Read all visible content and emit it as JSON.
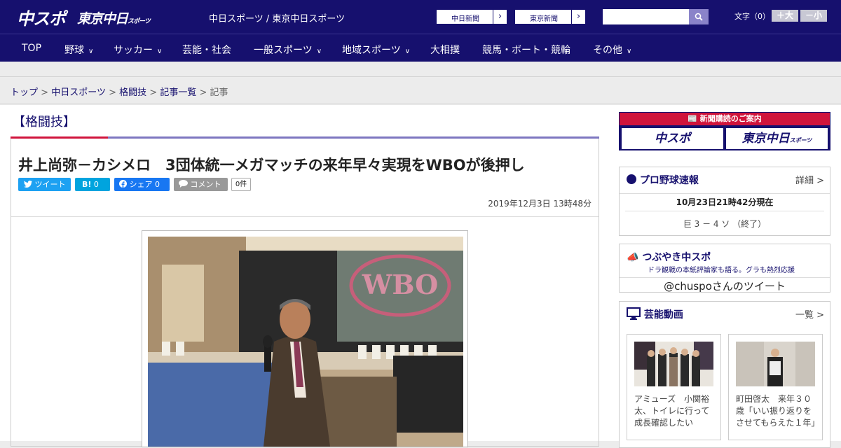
{
  "header": {
    "logo_main": "中スポ",
    "logo_tokyo": "東京中日",
    "logo_tokyo_small": "スポーツ",
    "site_name": "中日スポーツ / 東京中日スポーツ",
    "paper_buttons": [
      "中日新聞",
      "東京新聞"
    ],
    "search_placeholder": "",
    "font_size_label": "文字（0）",
    "font_larger": "＋大",
    "font_smaller": "－小"
  },
  "nav": {
    "items": [
      {
        "label": "TOP",
        "dropdown": false
      },
      {
        "label": "野球",
        "dropdown": true
      },
      {
        "label": "サッカー",
        "dropdown": true
      },
      {
        "label": "芸能・社会",
        "dropdown": false
      },
      {
        "label": "一般スポーツ",
        "dropdown": true
      },
      {
        "label": "地域スポーツ",
        "dropdown": true
      },
      {
        "label": "大相撲",
        "dropdown": false
      },
      {
        "label": "競馬・ボート・競輪",
        "dropdown": false
      },
      {
        "label": "その他",
        "dropdown": true
      }
    ]
  },
  "breadcrumb": {
    "items": [
      "トップ",
      "中日スポーツ",
      "格闘技",
      "記事一覧"
    ],
    "current": "記事",
    "separator": ">"
  },
  "article": {
    "category": "【格闘技】",
    "headline": "井上尚弥－カシメロ　3団体統一メガマッチの来年早々実現をWBOが後押し",
    "share": {
      "tweet": "ツイート",
      "hatena": "B!",
      "hatena_count": "0",
      "facebook": "シェア",
      "facebook_count": "0",
      "comment": "コメント",
      "comment_count": "0件"
    },
    "date": "2019年12月3日 13時48分",
    "photo_sign": "WBO"
  },
  "sidebar": {
    "promo": {
      "header": "新聞購読のご案内",
      "logo1": "中スポ",
      "logo2": "東京中日",
      "logo2_small": "スポーツ"
    },
    "baseball": {
      "title": "プロ野球速報",
      "more": "詳細 >",
      "time": "10月23日21時42分現在",
      "score": "巨 3 － 4 ソ （終了）"
    },
    "tweets": {
      "title": "つぶやき中スポ",
      "subtitle": "ドラ観戦の本紙評論家も語る。グラも熱烈応援",
      "account": "@chuspoさんのツイート"
    },
    "videos": {
      "title": "芸能動画",
      "more": "一覧 >",
      "items": [
        {
          "caption": "アミューズ　小関裕太、トイレに行って成長確認したい"
        },
        {
          "caption": "町田啓太　来年３０歳「いい振り返りをさせてもらえた１年」"
        }
      ]
    }
  },
  "colors": {
    "brand": "#16106e",
    "accent": "#d0143c",
    "twitter": "#1da1f2",
    "hatena": "#00a4de",
    "facebook": "#1877f2",
    "comment": "#999999"
  }
}
